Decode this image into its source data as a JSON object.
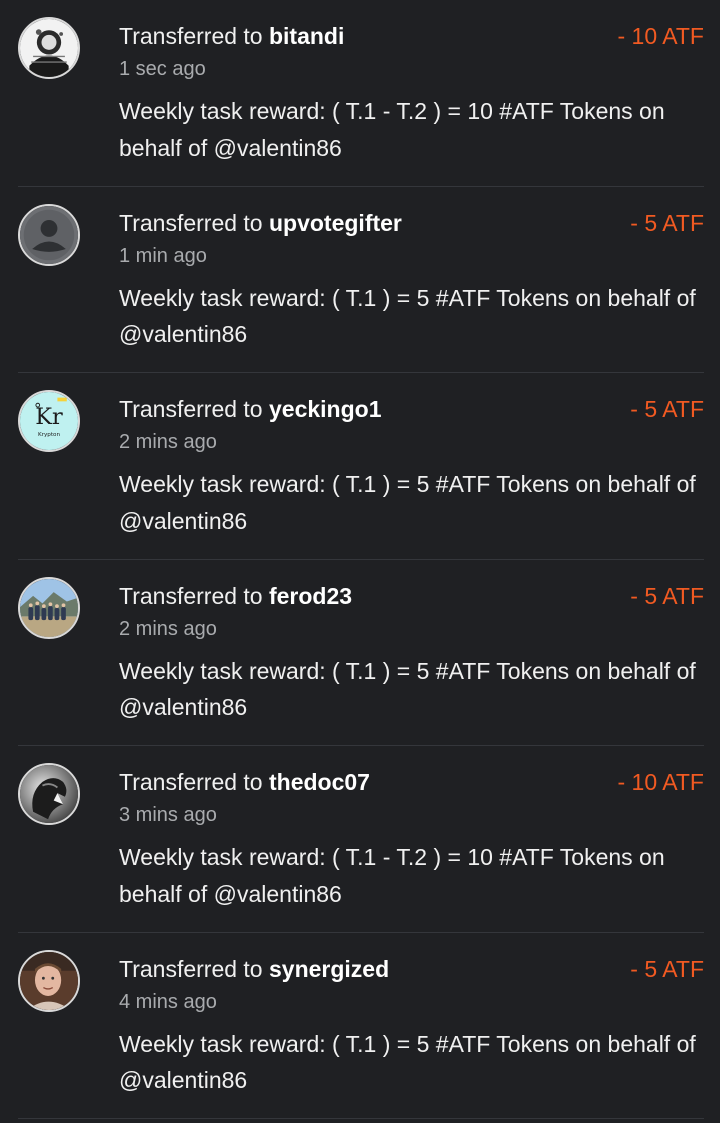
{
  "transfers": [
    {
      "prefix": "Transferred to",
      "user": "bitandi",
      "amount": "- 10 ATF",
      "time": "1 sec ago",
      "memo": "Weekly task reward: ( T.1 - T.2 ) = 10 #ATF Tokens on behalf of @valentin86",
      "avatar_icon": "user-avatar-icon"
    },
    {
      "prefix": "Transferred to",
      "user": "upvotegifter",
      "amount": "- 5 ATF",
      "time": "1 min ago",
      "memo": "Weekly task reward: ( T.1 ) = 5 #ATF Tokens on behalf of @valentin86",
      "avatar_icon": "default-avatar-icon"
    },
    {
      "prefix": "Transferred to",
      "user": "yeckingo1",
      "amount": "- 5 ATF",
      "time": "2 mins ago",
      "memo": "Weekly task reward: ( T.1 ) = 5 #ATF Tokens on behalf of @valentin86",
      "avatar_icon": "krypton-element-icon",
      "avatar_text": {
        "symbol": "Kr",
        "name": "Krypton"
      }
    },
    {
      "prefix": "Transferred to",
      "user": "ferod23",
      "amount": "- 5 ATF",
      "time": "2 mins ago",
      "memo": "Weekly task reward: ( T.1 ) = 5 #ATF Tokens on behalf of @valentin86",
      "avatar_icon": "group-photo-avatar-icon"
    },
    {
      "prefix": "Transferred to",
      "user": "thedoc07",
      "amount": "- 10 ATF",
      "time": "3 mins ago",
      "memo": "Weekly task reward: ( T.1 - T.2 ) = 10 #ATF Tokens on behalf of @valentin86",
      "avatar_icon": "lion-avatar-icon"
    },
    {
      "prefix": "Transferred to",
      "user": "synergized",
      "amount": "- 5 ATF",
      "time": "4 mins ago",
      "memo": "Weekly task reward: ( T.1 ) = 5 #ATF Tokens on behalf of @valentin86",
      "avatar_icon": "person-photo-avatar-icon"
    }
  ],
  "colors": {
    "background": "#1f2023",
    "amount": "#f15a22",
    "muted": "#a9abae",
    "text": "#f0f0f0"
  }
}
